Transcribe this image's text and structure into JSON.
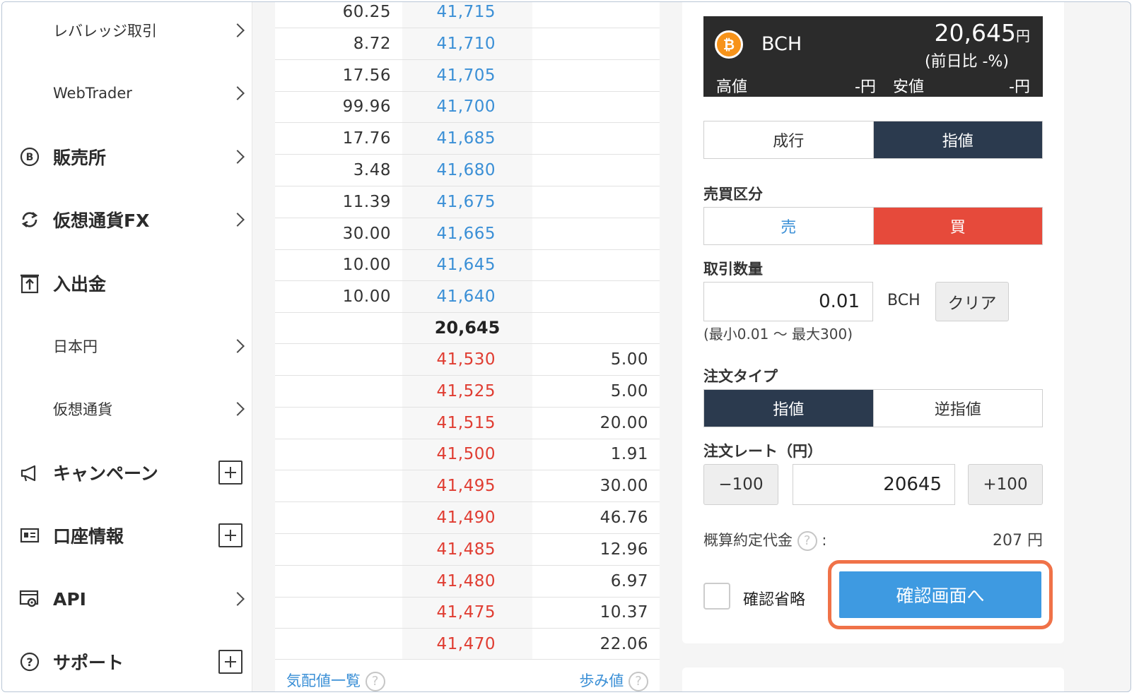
{
  "sidebar": {
    "items": [
      {
        "label": "レバレッジ取引",
        "icon": "",
        "suffix": "chevron"
      },
      {
        "label": "WebTrader",
        "icon": "",
        "suffix": "chevron"
      },
      {
        "label": "販売所",
        "icon": "bitcoin-circle-icon",
        "suffix": "chevron"
      },
      {
        "label": "仮想通貨FX",
        "icon": "exchange-arrows-icon",
        "suffix": "chevron"
      },
      {
        "label": "入出金",
        "icon": "deposit-icon",
        "suffix": ""
      },
      {
        "label": "日本円",
        "icon": "",
        "suffix": "chevron"
      },
      {
        "label": "仮想通貨",
        "icon": "",
        "suffix": "chevron"
      },
      {
        "label": "キャンペーン",
        "icon": "megaphone-icon",
        "suffix": "plus"
      },
      {
        "label": "口座情報",
        "icon": "id-card-icon",
        "suffix": "plus"
      },
      {
        "label": "API",
        "icon": "api-gear-icon",
        "suffix": "chevron"
      },
      {
        "label": "サポート",
        "icon": "help-circle-icon",
        "suffix": "plus"
      }
    ]
  },
  "orderbook": {
    "asks": [
      {
        "qty": "60.25",
        "price": "41,715"
      },
      {
        "qty": "8.72",
        "price": "41,710"
      },
      {
        "qty": "17.56",
        "price": "41,705"
      },
      {
        "qty": "99.96",
        "price": "41,700"
      },
      {
        "qty": "17.76",
        "price": "41,685"
      },
      {
        "qty": "3.48",
        "price": "41,680"
      },
      {
        "qty": "11.39",
        "price": "41,675"
      },
      {
        "qty": "30.00",
        "price": "41,665"
      },
      {
        "qty": "10.00",
        "price": "41,645"
      },
      {
        "qty": "10.00",
        "price": "41,640"
      }
    ],
    "mid_price": "20,645",
    "bids": [
      {
        "price": "41,530",
        "qty": "5.00"
      },
      {
        "price": "41,525",
        "qty": "5.00"
      },
      {
        "price": "41,515",
        "qty": "20.00"
      },
      {
        "price": "41,500",
        "qty": "1.91"
      },
      {
        "price": "41,495",
        "qty": "30.00"
      },
      {
        "price": "41,490",
        "qty": "46.76"
      },
      {
        "price": "41,485",
        "qty": "12.96"
      },
      {
        "price": "41,480",
        "qty": "6.97"
      },
      {
        "price": "41,475",
        "qty": "10.37"
      },
      {
        "price": "41,470",
        "qty": "22.06"
      }
    ],
    "footer_left": "気配値一覧",
    "footer_right": "歩み値",
    "colors": {
      "ask": "#3a8fd6",
      "bid": "#e03c31"
    }
  },
  "ticker": {
    "coin_glyph": "₿",
    "symbol": "BCH",
    "last_price": "20,645",
    "last_unit": "円",
    "change": "(前日比 -%)",
    "high_label": "高値",
    "high_value": "-円",
    "low_label": "安値",
    "low_value": "-円"
  },
  "order_form": {
    "type_tabs": [
      "成行",
      "指値"
    ],
    "type_selected": "指値",
    "side_label": "売買区分",
    "side_tabs": [
      "売",
      "買"
    ],
    "side_selected": "買",
    "qty_label": "取引数量",
    "qty_value": "0.01",
    "qty_unit": "BCH",
    "clear_label": "クリア",
    "qty_range": "(最小0.01 〜 最大300)",
    "order_type_label": "注文タイプ",
    "order_type_tabs": [
      "指値",
      "逆指値"
    ],
    "order_type_selected": "指値",
    "rate_label": "注文レート（円）",
    "minus_label": "−100",
    "rate_value": "20645",
    "plus_label": "+100",
    "estimate_label": "概算約定代金",
    "estimate_colon": ":",
    "estimate_value": "207 円",
    "skip_confirm_label": "確認省略",
    "confirm_label": "確認画面へ",
    "colors": {
      "dark": "#2b3a4e",
      "buy": "#e64a3b",
      "confirm": "#3e9ae1",
      "highlight": "#f07248"
    }
  }
}
